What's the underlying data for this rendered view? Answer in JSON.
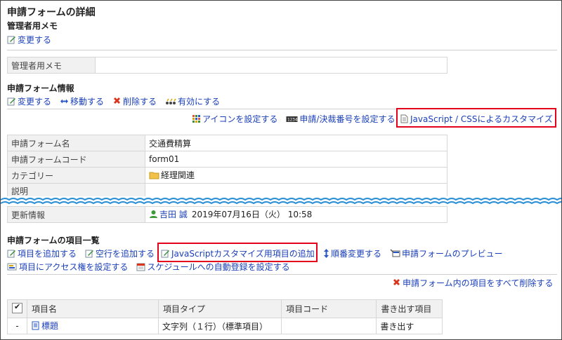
{
  "page_title": "申請フォームの詳細",
  "admin_memo": {
    "heading": "管理者用メモ",
    "edit_label": "変更する",
    "field_label": "管理者用メモ",
    "field_value": ""
  },
  "form_info": {
    "heading": "申請フォーム情報",
    "actions": [
      {
        "name": "edit-button",
        "icon": "edit-icon",
        "label": "変更する"
      },
      {
        "name": "move-button",
        "icon": "move-icon",
        "label": "移動する"
      },
      {
        "name": "delete-button",
        "icon": "delete-icon",
        "label": "削除する"
      },
      {
        "name": "enable-button",
        "icon": "enable-icon",
        "label": "有効にする"
      }
    ],
    "sub_actions": [
      {
        "name": "set-icon-button",
        "icon": "grid-icon",
        "label": "アイコンを設定する"
      },
      {
        "name": "set-number-button",
        "icon": "number-icon",
        "label": "申請/決裁番号を設定する"
      },
      {
        "name": "js-css-customize-link",
        "icon": "document-icon",
        "label": "JavaScript / CSSによるカスタマイズ"
      }
    ],
    "rows": [
      {
        "label": "申請フォーム名",
        "value": "交通費精算"
      },
      {
        "label": "申請フォームコード",
        "value": "form01"
      },
      {
        "label": "カテゴリー",
        "value": "経理関連"
      },
      {
        "label": "説明",
        "value": ""
      }
    ],
    "updated": {
      "label": "更新情報",
      "user": "吉田 誠",
      "datetime": "2019年07月16日（火） 10:58"
    }
  },
  "item_list": {
    "heading": "申請フォームの項目一覧",
    "actions": [
      {
        "name": "add-item-button",
        "icon": "edit-icon",
        "label": "項目を追加する"
      },
      {
        "name": "add-blank-row-button",
        "icon": "edit-icon",
        "label": "空行を追加する"
      },
      {
        "name": "add-js-item-button",
        "icon": "edit-icon",
        "label": "JavaScriptカスタマイズ用項目の追加"
      },
      {
        "name": "reorder-button",
        "icon": "updown-icon",
        "label": "順番変更する"
      },
      {
        "name": "preview-button",
        "icon": "preview-icon",
        "label": "申請フォームのプレビュー"
      }
    ],
    "actions2": [
      {
        "name": "set-access-button",
        "icon": "access-icon",
        "label": "項目にアクセス権を設定する"
      },
      {
        "name": "schedule-register-button",
        "icon": "calendar-icon",
        "label": "スケジュールへの自動登録を設定する"
      }
    ],
    "delete_all_label": "申請フォーム内の項目をすべて削除する",
    "columns": [
      "項目名",
      "項目タイプ",
      "項目コード",
      "書き出す項目"
    ],
    "rows": [
      {
        "mark": "-",
        "name": "標題",
        "type": "文字列（１行）（標準項目）",
        "code": "",
        "export": "書き出す"
      }
    ]
  },
  "colors": {
    "link": "#1a3fb8",
    "highlight": "#e2001a",
    "wave": "#2b8fd6"
  }
}
